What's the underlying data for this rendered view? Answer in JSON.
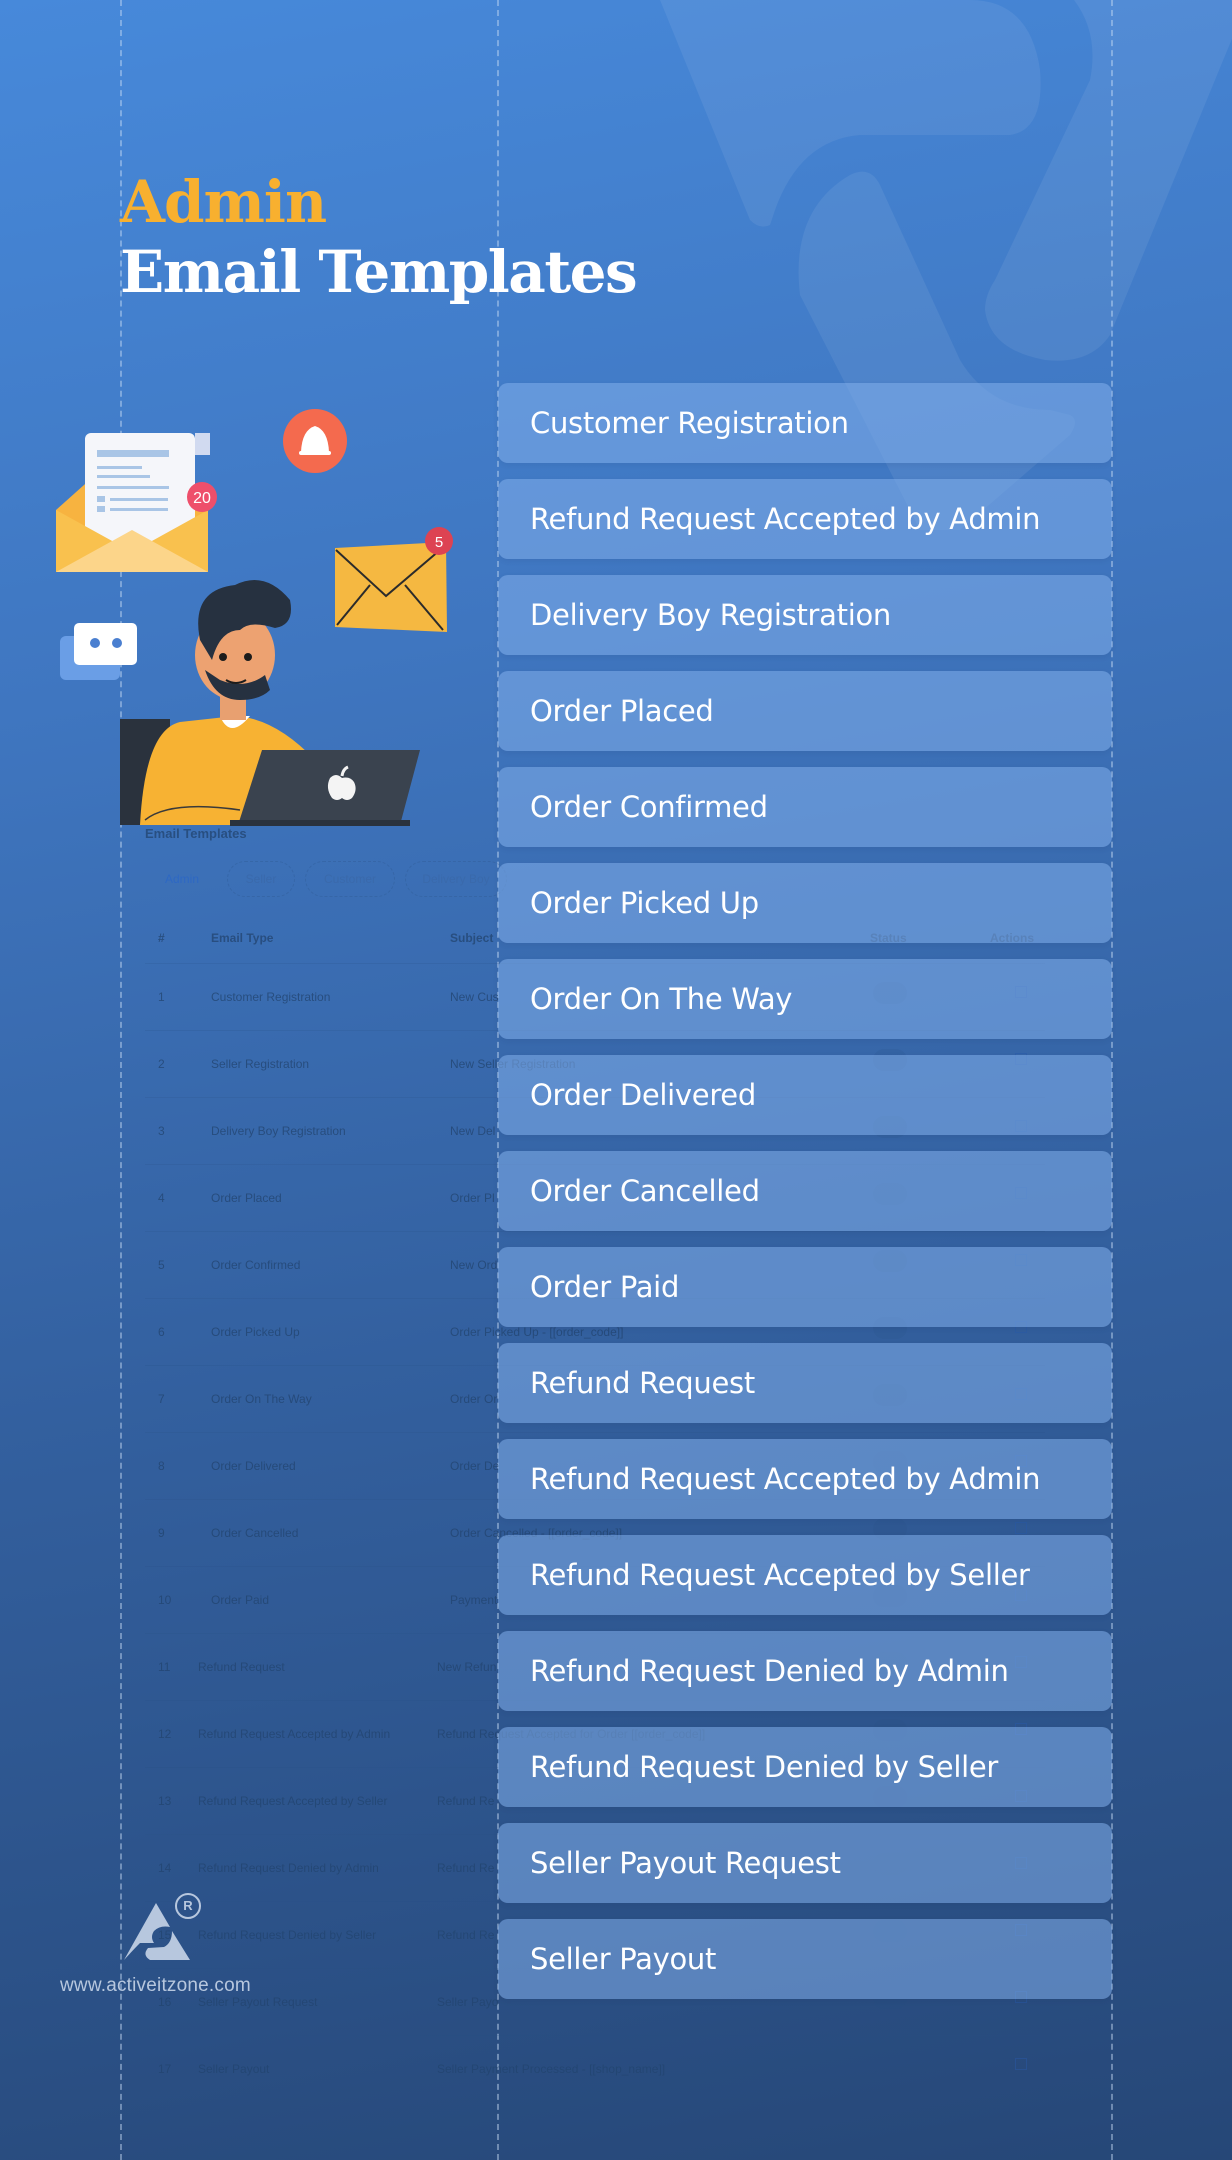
{
  "header": {
    "title_accent": "Admin",
    "title_main": "Email Templates"
  },
  "colors": {
    "accent": "#f8b02f",
    "background_top": "#4789da",
    "background_bottom": "#264777",
    "card": "#6a9be0"
  },
  "illustration": {
    "envelope_badge": "20",
    "mail_badge": "5",
    "icons": [
      "open-envelope-icon",
      "bell-icon",
      "envelope-icon",
      "chat-bubble-icon",
      "laptop-icon",
      "person-illustration"
    ]
  },
  "templates": [
    "Customer Registration",
    "Refund Request Accepted by Admin",
    "Delivery Boy Registration",
    "Order Placed",
    "Order Confirmed",
    "Order Picked Up",
    "Order On The Way",
    "Order Delivered",
    "Order Cancelled",
    "Order Paid",
    "Refund Request",
    "Refund Request Accepted by Admin",
    "Refund Request Accepted by Seller",
    "Refund Request Denied by Admin",
    "Refund Request Denied by Seller",
    "Seller Payout Request",
    "Seller Payout"
  ],
  "background_table": {
    "heading": "Email Templates",
    "tabs": [
      "Admin",
      "Seller",
      "Customer",
      "Delivery Boy"
    ],
    "active_tab": "Admin",
    "columns": [
      "#",
      "Email Type",
      "Subject",
      "Status",
      "Actions"
    ],
    "rows": [
      {
        "num": "1",
        "type": "Customer Registration",
        "subject": "New Cus"
      },
      {
        "num": "2",
        "type": "Seller Registration",
        "subject": "New Seller Registration"
      },
      {
        "num": "3",
        "type": "Delivery Boy Registration",
        "subject": "New Del"
      },
      {
        "num": "4",
        "type": "Order Placed",
        "subject": "Order Pl"
      },
      {
        "num": "5",
        "type": "Order Confirmed",
        "subject": "New Ord"
      },
      {
        "num": "6",
        "type": "Order Picked Up",
        "subject": "Order Picked Up - [[order_code]]"
      },
      {
        "num": "7",
        "type": "Order On The Way",
        "subject": "Order Or"
      },
      {
        "num": "8",
        "type": "Order Delivered",
        "subject": "Order De"
      },
      {
        "num": "9",
        "type": "Order Cancelled",
        "subject": "Order Cancelled - [[order_code]]"
      },
      {
        "num": "10",
        "type": "Order Paid",
        "subject": "Payment"
      },
      {
        "num": "11",
        "type": "Refund Request",
        "subject": "New Refun"
      },
      {
        "num": "12",
        "type": "Refund Request Accepted by Admin",
        "subject": "Refund Request Accepted for Order [[order_code]]"
      },
      {
        "num": "13",
        "type": "Refund Request Accepted by Seller",
        "subject": "Refund Re"
      },
      {
        "num": "14",
        "type": "Refund Request Denied by Admin",
        "subject": "Refund Re"
      },
      {
        "num": "15",
        "type": "Refund Request Denied by Seller",
        "subject": "Refund Re"
      },
      {
        "num": "16",
        "type": "Seller Payout Request",
        "subject": "Seller Payo"
      },
      {
        "num": "17",
        "type": "Seller Payout",
        "subject": "Seller Payment Processed - [[shop_name]]"
      }
    ]
  },
  "footer": {
    "registered_mark": "R",
    "website": "www.activeitzone.com"
  }
}
